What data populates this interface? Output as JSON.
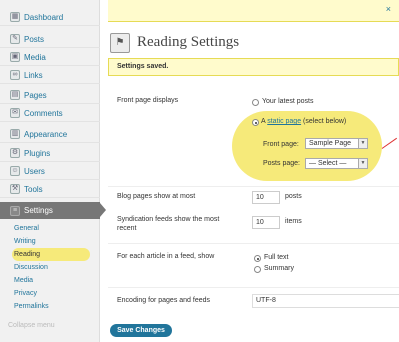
{
  "sidebar": {
    "items": [
      {
        "label": "Dashboard",
        "icon": "dashboard-icon",
        "glyph": "▦"
      },
      {
        "label": "Posts",
        "icon": "posts-icon",
        "glyph": "✎"
      },
      {
        "label": "Media",
        "icon": "media-icon",
        "glyph": "▣"
      },
      {
        "label": "Links",
        "icon": "links-icon",
        "glyph": "∞"
      },
      {
        "label": "Pages",
        "icon": "pages-icon",
        "glyph": "▤"
      },
      {
        "label": "Comments",
        "icon": "comments-icon",
        "glyph": "✉"
      },
      {
        "label": "Appearance",
        "icon": "appearance-icon",
        "glyph": "▥"
      },
      {
        "label": "Plugins",
        "icon": "plugins-icon",
        "glyph": "⚙"
      },
      {
        "label": "Users",
        "icon": "users-icon",
        "glyph": "☺"
      },
      {
        "label": "Tools",
        "icon": "tools-icon",
        "glyph": "⚒"
      },
      {
        "label": "Settings",
        "icon": "settings-icon",
        "glyph": "≡"
      }
    ],
    "submenu": [
      "General",
      "Writing",
      "Reading",
      "Discussion",
      "Media",
      "Privacy",
      "Permalinks"
    ],
    "collapse_label": "Collapse menu"
  },
  "topbar": {
    "close_glyph": "×"
  },
  "title": {
    "icon": "reading-settings-icon",
    "glyph": "⚑",
    "text": "Reading Settings"
  },
  "notice": "Settings saved.",
  "form": {
    "front_page_label": "Front page displays",
    "latest_posts": "Your latest posts",
    "static_page_prefix": "A ",
    "static_page_link": "static page",
    "static_page_suffix": " (select below)",
    "front_page_select_label": "Front page:",
    "front_page_select_value": "Sample Page",
    "posts_page_select_label": "Posts page:",
    "posts_page_select_value": "— Select —",
    "blog_pages_label": "Blog pages show at most",
    "blog_pages_value": "10",
    "blog_pages_unit": "posts",
    "syndication_label_1": "Syndication feeds show the most",
    "syndication_label_2": "recent",
    "syndication_value": "10",
    "syndication_unit": "items",
    "feed_article_label": "For each article in a feed, show",
    "full_text": "Full text",
    "summary": "Summary",
    "encoding_label": "Encoding for pages and feeds",
    "encoding_value": "UTF-8"
  },
  "save_button": "Save Changes",
  "colors": {
    "highlight": "#f6ea7a",
    "link": "#21759b",
    "button": "#21759b"
  }
}
